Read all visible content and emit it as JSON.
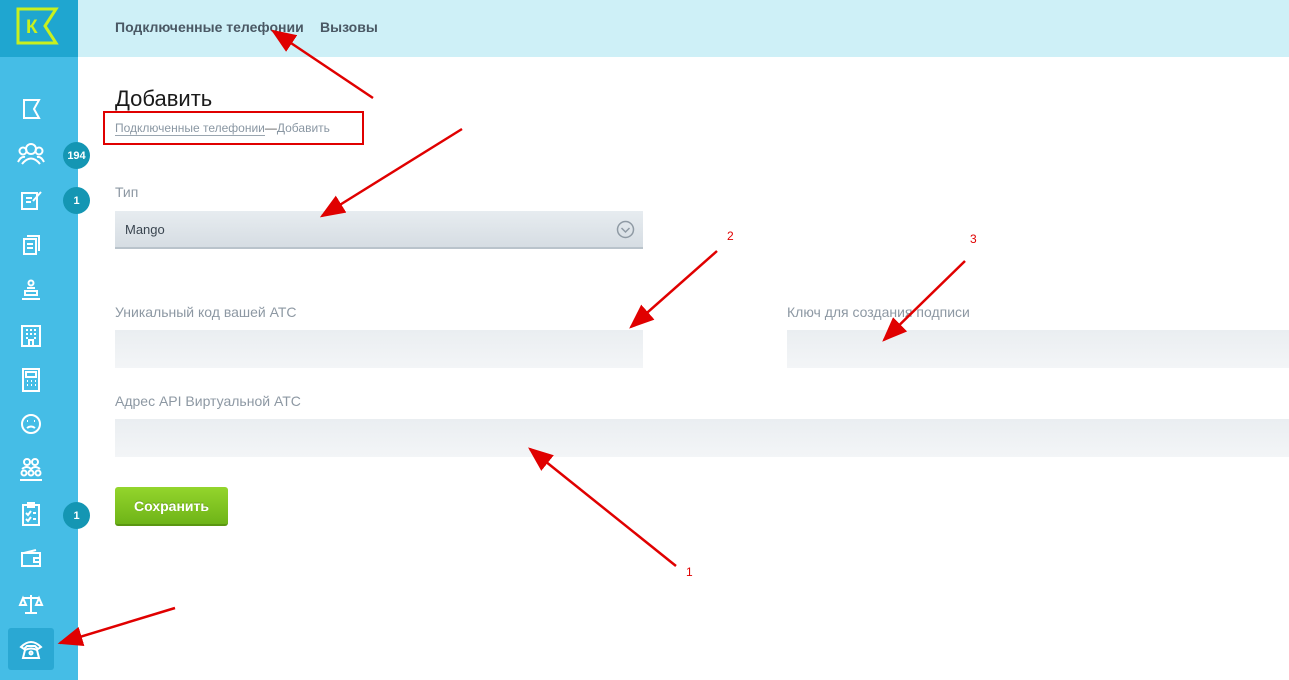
{
  "app": {
    "logo_letter": "К",
    "accent": "#45bde6",
    "logo_color": "#c8f01e"
  },
  "topnav": {
    "tabs": [
      {
        "label": "Подключенные телефонии"
      },
      {
        "label": "Вызовы"
      }
    ]
  },
  "sidebar": {
    "items": [
      {
        "icon": "flag-icon"
      },
      {
        "icon": "users-icon",
        "badge": "194"
      },
      {
        "icon": "edit-note-icon",
        "badge": "1"
      },
      {
        "icon": "documents-icon"
      },
      {
        "icon": "reception-icon"
      },
      {
        "icon": "building-icon"
      },
      {
        "icon": "calculator-icon"
      },
      {
        "icon": "sad-face-icon"
      },
      {
        "icon": "group-icon"
      },
      {
        "icon": "checklist-icon",
        "badge": "1"
      },
      {
        "icon": "wallet-icon"
      },
      {
        "icon": "scales-icon"
      },
      {
        "icon": "phone-icon",
        "active": true
      }
    ]
  },
  "page": {
    "title": "Добавить",
    "breadcrumb": {
      "link": "Подключенные телефонии",
      "separator": "—",
      "current": "Добавить"
    }
  },
  "form": {
    "type_label": "Тип",
    "type_value": "Mango",
    "ats_code_label": "Уникальный код вашей АТС",
    "ats_code_value": "",
    "sign_key_label": "Ключ для создания подписи",
    "sign_key_value": "",
    "api_address_label": "Адрес API Виртуальной АТС",
    "api_address_value": "",
    "save_label": "Сохранить"
  },
  "annotations": {
    "one": "1",
    "two": "2",
    "three": "3",
    "color": "#e00000"
  }
}
